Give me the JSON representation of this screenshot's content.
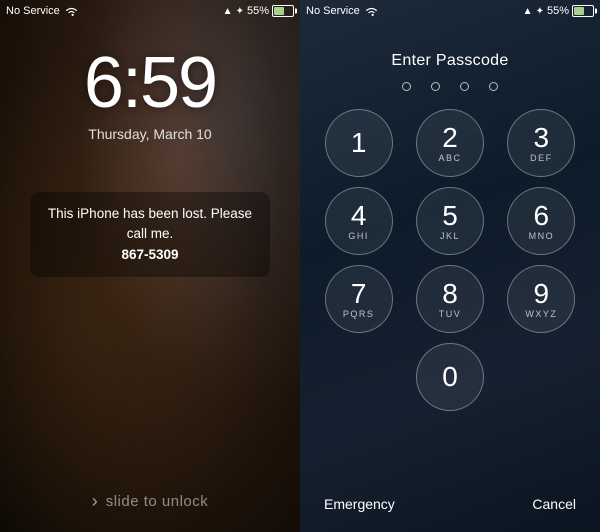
{
  "left": {
    "status": {
      "service": "No Service",
      "battery_pct": "55%"
    },
    "time": "6:59",
    "date": "Thursday, March 10",
    "message_line1": "This iPhone has been lost. Please call",
    "message_line2": "me.",
    "phone_number": "867-5309",
    "slide_text": "slide to unlock"
  },
  "right": {
    "status": {
      "service": "No Service",
      "battery_pct": "55%"
    },
    "title": "Enter Passcode",
    "dots": [
      {
        "empty": true
      },
      {
        "empty": true
      },
      {
        "empty": true
      },
      {
        "empty": true
      }
    ],
    "numpad": [
      {
        "main": "1",
        "sub": ""
      },
      {
        "main": "2",
        "sub": "ABC"
      },
      {
        "main": "3",
        "sub": "DEF"
      },
      {
        "main": "4",
        "sub": "GHI"
      },
      {
        "main": "5",
        "sub": "JKL"
      },
      {
        "main": "6",
        "sub": "MNO"
      },
      {
        "main": "7",
        "sub": "PQRS"
      },
      {
        "main": "8",
        "sub": "TUV"
      },
      {
        "main": "9",
        "sub": "WXYZ"
      }
    ],
    "zero": {
      "main": "0",
      "sub": ""
    },
    "emergency": "Emergency",
    "cancel": "Cancel"
  }
}
